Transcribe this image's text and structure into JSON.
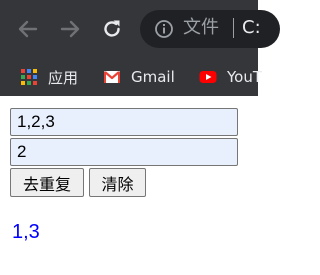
{
  "browser": {
    "url_label": "文件",
    "url_text": "C:",
    "bookmarks": [
      {
        "label": "应用",
        "icon": "apps-grid-icon"
      },
      {
        "label": "Gmail",
        "icon": "gmail-icon"
      },
      {
        "label": "YouT",
        "icon": "youtube-icon"
      }
    ]
  },
  "form": {
    "input1_value": "1,2,3",
    "input2_value": "2",
    "dedupe_label": "去重复",
    "clear_label": "清除"
  },
  "result": {
    "text": "1,3"
  },
  "colors": {
    "chrome_bg": "#35363a",
    "input_autofill_bg": "#e8f0fe",
    "result_text": "#0000ff"
  }
}
